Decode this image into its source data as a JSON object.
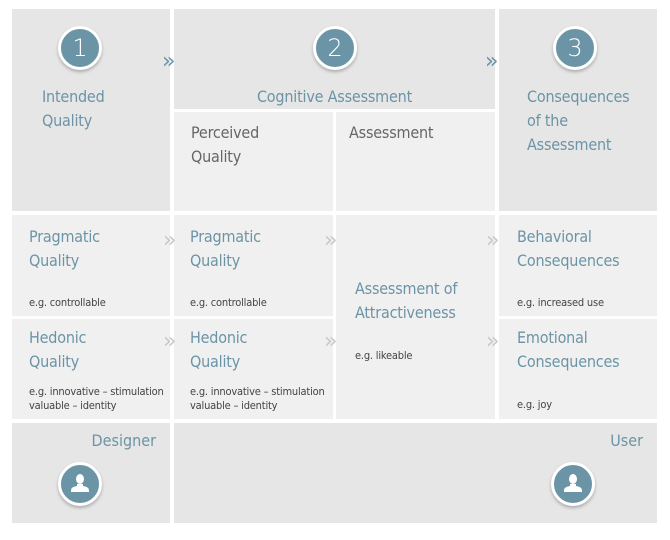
{
  "stages": [
    {
      "number": "1",
      "title": "Intended Quality",
      "title_lines": [
        "Intended",
        "Quality"
      ]
    },
    {
      "number": "2",
      "title": "Cognitive Assessment"
    },
    {
      "number": "3",
      "title": "Consequences of the Assessment",
      "title_lines": [
        "Consequences",
        "of the",
        "Assessment"
      ]
    }
  ],
  "subheaders": {
    "perceived_quality_lines": [
      "Perceived",
      "Quality"
    ],
    "assessment": "Assessment"
  },
  "designer_column": {
    "pragmatic": {
      "title_lines": [
        "Pragmatic",
        "Quality"
      ],
      "example": "e.g. controllable"
    },
    "hedonic": {
      "title_lines": [
        "Hedonic",
        "Quality"
      ],
      "example_lines": [
        "e.g. innovative – stimulation",
        "valuable – identity"
      ]
    }
  },
  "perceived_column": {
    "pragmatic": {
      "title_lines": [
        "Pragmatic",
        "Quality"
      ],
      "example": "e.g. controllable"
    },
    "hedonic": {
      "title_lines": [
        "Hedonic",
        "Quality"
      ],
      "example_lines": [
        "e.g. innovative – stimulation",
        "valuable – identity"
      ]
    }
  },
  "assessment_column": {
    "title_lines": [
      "Assessment of",
      "Attractiveness"
    ],
    "example": "e.g. likeable"
  },
  "consequences_column": {
    "behavioral": {
      "title_lines": [
        "Behavioral",
        "Consequences"
      ],
      "example": "e.g. increased use"
    },
    "emotional": {
      "title_lines": [
        "Emotional",
        "Consequences"
      ],
      "example": "e.g. joy"
    }
  },
  "roles": {
    "designer": "Designer",
    "user": "User"
  },
  "icons": {
    "arrow": "»",
    "person": "person-icon"
  },
  "colors": {
    "accent": "#6b94a6",
    "cell_dark": "#e6e6e6",
    "cell_light": "#f0f0f0",
    "chevron_light": "#c8c8c8",
    "text_gray": "#666666"
  }
}
